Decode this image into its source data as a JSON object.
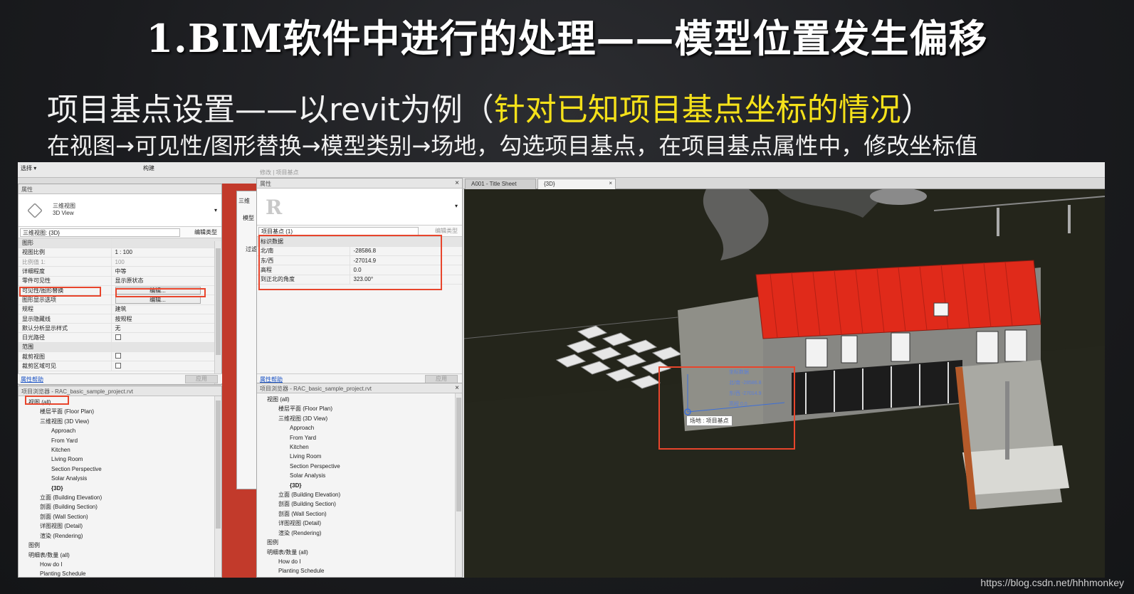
{
  "slide": {
    "title": "1.BIM软件中进行的处理——模型位置发生偏移",
    "subtitle_prefix": "项目基点设置——以revit为例（",
    "subtitle_highlight": "针对已知项目基点坐标的情况",
    "subtitle_suffix": "）",
    "instruction": "在视图→可见性/图形替换→模型类别→场地，勾选项目基点，在项目基点属性中，修改坐标值",
    "watermark": "https://blog.csdn.net/hhhmonkey",
    "highlight_color": "#f5e11a"
  },
  "ribbon": {
    "select_label": "选择 ▾",
    "build_label": "构建",
    "modify_label": "修改 | 项目基点"
  },
  "left_props": {
    "title": "属性",
    "type_name": "三维视图",
    "type_sub": "3D View",
    "instance_selector": "三维视图: {3D}",
    "edit_type": "编辑类型",
    "rows": [
      {
        "k": "图形",
        "v": "",
        "group": true
      },
      {
        "k": "视图比例",
        "v": "1 : 100"
      },
      {
        "k": "比例值 1:",
        "v": "100",
        "dim": true
      },
      {
        "k": "详细程度",
        "v": "中等"
      },
      {
        "k": "零件可见性",
        "v": "显示原状态"
      },
      {
        "k": "可见性/图形替换",
        "v": "编辑...",
        "button": true
      },
      {
        "k": "图形显示选项",
        "v": "编辑...",
        "button": true
      },
      {
        "k": "规程",
        "v": "建筑"
      },
      {
        "k": "显示隐藏线",
        "v": "按规程"
      },
      {
        "k": "默认分析显示样式",
        "v": "无"
      },
      {
        "k": "日光路径",
        "v": "",
        "check": true
      },
      {
        "k": "范围",
        "v": "",
        "group": true
      },
      {
        "k": "裁剪视图",
        "v": "",
        "check": true
      },
      {
        "k": "裁剪区域可见",
        "v": "",
        "check": true
      }
    ],
    "help": "属性帮助",
    "apply": "应用"
  },
  "left_browser": {
    "title": "项目浏览器 - RAC_basic_sample_project.rvt",
    "items": [
      {
        "t": "视图 (all)",
        "lvl": 0
      },
      {
        "t": "楼层平面 (Floor Plan)",
        "lvl": 1
      },
      {
        "t": "三维视图 (3D View)",
        "lvl": 1
      },
      {
        "t": "Approach",
        "lvl": 2
      },
      {
        "t": "From Yard",
        "lvl": 2
      },
      {
        "t": "Kitchen",
        "lvl": 2
      },
      {
        "t": "Living Room",
        "lvl": 2
      },
      {
        "t": "Section Perspective",
        "lvl": 2
      },
      {
        "t": "Solar Analysis",
        "lvl": 2
      },
      {
        "t": "{3D}",
        "lvl": 2,
        "bold": true
      },
      {
        "t": "立面 (Building Elevation)",
        "lvl": 1
      },
      {
        "t": "剖面 (Building Section)",
        "lvl": 1
      },
      {
        "t": "剖面 (Wall Section)",
        "lvl": 1
      },
      {
        "t": "详图视图 (Detail)",
        "lvl": 1
      },
      {
        "t": "渲染 (Rendering)",
        "lvl": 1
      },
      {
        "t": "图例",
        "lvl": 0
      },
      {
        "t": "明细表/数量 (all)",
        "lvl": 0
      },
      {
        "t": "How do I",
        "lvl": 1
      },
      {
        "t": "Planting Schedule",
        "lvl": 1
      }
    ]
  },
  "mid_dialog": {
    "title": "三维",
    "label1": "模型",
    "label2": "过滤"
  },
  "right_props": {
    "title": "属性",
    "selector": "项目基点 (1)",
    "edit_type": "编辑类型",
    "group": "标识数据",
    "rows": [
      {
        "k": "北/南",
        "v": "-28586.8"
      },
      {
        "k": "东/西",
        "v": "-27014.9"
      },
      {
        "k": "高程",
        "v": "0.0"
      },
      {
        "k": "到正北的角度",
        "v": "323.00°"
      }
    ],
    "help": "属性帮助",
    "apply": "应用"
  },
  "right_browser": {
    "title": "项目浏览器 - RAC_basic_sample_project.rvt",
    "items": [
      {
        "t": "视图 (all)",
        "lvl": 0
      },
      {
        "t": "楼层平面 (Floor Plan)",
        "lvl": 1
      },
      {
        "t": "三维视图 (3D View)",
        "lvl": 1
      },
      {
        "t": "Approach",
        "lvl": 2
      },
      {
        "t": "From Yard",
        "lvl": 2
      },
      {
        "t": "Kitchen",
        "lvl": 2
      },
      {
        "t": "Living Room",
        "lvl": 2
      },
      {
        "t": "Section Perspective",
        "lvl": 2
      },
      {
        "t": "Solar Analysis",
        "lvl": 2
      },
      {
        "t": "{3D}",
        "lvl": 2,
        "bold": true
      },
      {
        "t": "立面 (Building Elevation)",
        "lvl": 1
      },
      {
        "t": "剖面 (Building Section)",
        "lvl": 1
      },
      {
        "t": "剖面 (Wall Section)",
        "lvl": 1
      },
      {
        "t": "详图视图 (Detail)",
        "lvl": 1
      },
      {
        "t": "渲染 (Rendering)",
        "lvl": 1
      },
      {
        "t": "图例",
        "lvl": 0
      },
      {
        "t": "明细表/数量 (all)",
        "lvl": 0
      },
      {
        "t": "How do I",
        "lvl": 1
      },
      {
        "t": "Planting Schedule",
        "lvl": 1
      }
    ]
  },
  "view_tabs": [
    {
      "label": "A001 - Title Sheet",
      "active": false
    },
    {
      "label": "{3D}",
      "active": true
    }
  ],
  "view3d": {
    "tooltip": "场地 : 项目基点",
    "overlay_lines": [
      "北/南   -28586.8",
      "东/西   -27014.9",
      "高程   0.0"
    ],
    "overlay_head": "坐标数据"
  }
}
